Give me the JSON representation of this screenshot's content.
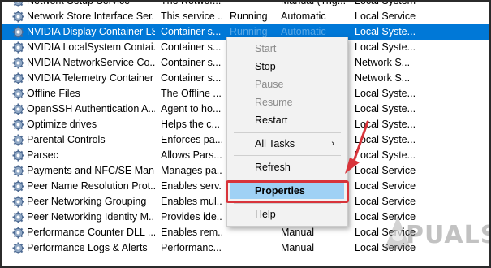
{
  "services": [
    {
      "name": "Network Setup Service",
      "desc": "The Networ...",
      "status": "",
      "startup": "Manual (Trig...",
      "logon": "Local System"
    },
    {
      "name": "Network Store Interface Ser...",
      "desc": "This service ...",
      "status": "Running",
      "startup": "Automatic",
      "logon": "Local Service"
    },
    {
      "name": "NVIDIA Display Container LS",
      "desc": "Container s...",
      "status": "Running",
      "startup": "Automatic",
      "logon": "Local Syste...",
      "selected": true
    },
    {
      "name": "NVIDIA LocalSystem Contai...",
      "desc": "Container s...",
      "status": "",
      "startup": "",
      "logon": "Local Syste..."
    },
    {
      "name": "NVIDIA NetworkService Co...",
      "desc": "Container s...",
      "status": "",
      "startup": "",
      "logon": "Network S..."
    },
    {
      "name": "NVIDIA Telemetry Container",
      "desc": "Container s...",
      "status": "",
      "startup": "",
      "logon": "Network S..."
    },
    {
      "name": "Offline Files",
      "desc": "The Offline ...",
      "status": "",
      "startup": "",
      "logon": "Local Syste..."
    },
    {
      "name": "OpenSSH Authentication A...",
      "desc": "Agent to ho...",
      "status": "",
      "startup": "",
      "logon": "Local Syste..."
    },
    {
      "name": "Optimize drives",
      "desc": "Helps the c...",
      "status": "",
      "startup": "",
      "logon": "Local Syste..."
    },
    {
      "name": "Parental Controls",
      "desc": "Enforces pa...",
      "status": "",
      "startup": "",
      "logon": "Local Syste..."
    },
    {
      "name": "Parsec",
      "desc": "Allows Pars...",
      "status": "",
      "startup": "",
      "logon": "Local Syste..."
    },
    {
      "name": "Payments and NFC/SE Man...",
      "desc": "Manages pa...",
      "status": "",
      "startup": "",
      "logon": "Local Service"
    },
    {
      "name": "Peer Name Resolution Prot...",
      "desc": "Enables serv...",
      "status": "",
      "startup": "",
      "logon": "Local Service"
    },
    {
      "name": "Peer Networking Grouping",
      "desc": "Enables mul...",
      "status": "",
      "startup": "",
      "logon": "Local Service"
    },
    {
      "name": "Peer Networking Identity M...",
      "desc": "Provides ide...",
      "status": "",
      "startup": "",
      "logon": "Local Service"
    },
    {
      "name": "Performance Counter DLL ...",
      "desc": "Enables rem...",
      "status": "",
      "startup": "Manual",
      "logon": "Local Service"
    },
    {
      "name": "Performance Logs & Alerts",
      "desc": "Performanc...",
      "status": "",
      "startup": "Manual",
      "logon": "Local Service"
    }
  ],
  "context_menu": {
    "start": "Start",
    "stop": "Stop",
    "pause": "Pause",
    "resume": "Resume",
    "restart": "Restart",
    "all_tasks": "All Tasks",
    "all_tasks_arrow": "›",
    "refresh": "Refresh",
    "properties": "Properties",
    "help": "Help"
  },
  "watermark": "PUALS",
  "colors": {
    "selection": "#0078d7",
    "menu_highlight": "#9fd1f5",
    "annotation_red": "#d8343b"
  }
}
